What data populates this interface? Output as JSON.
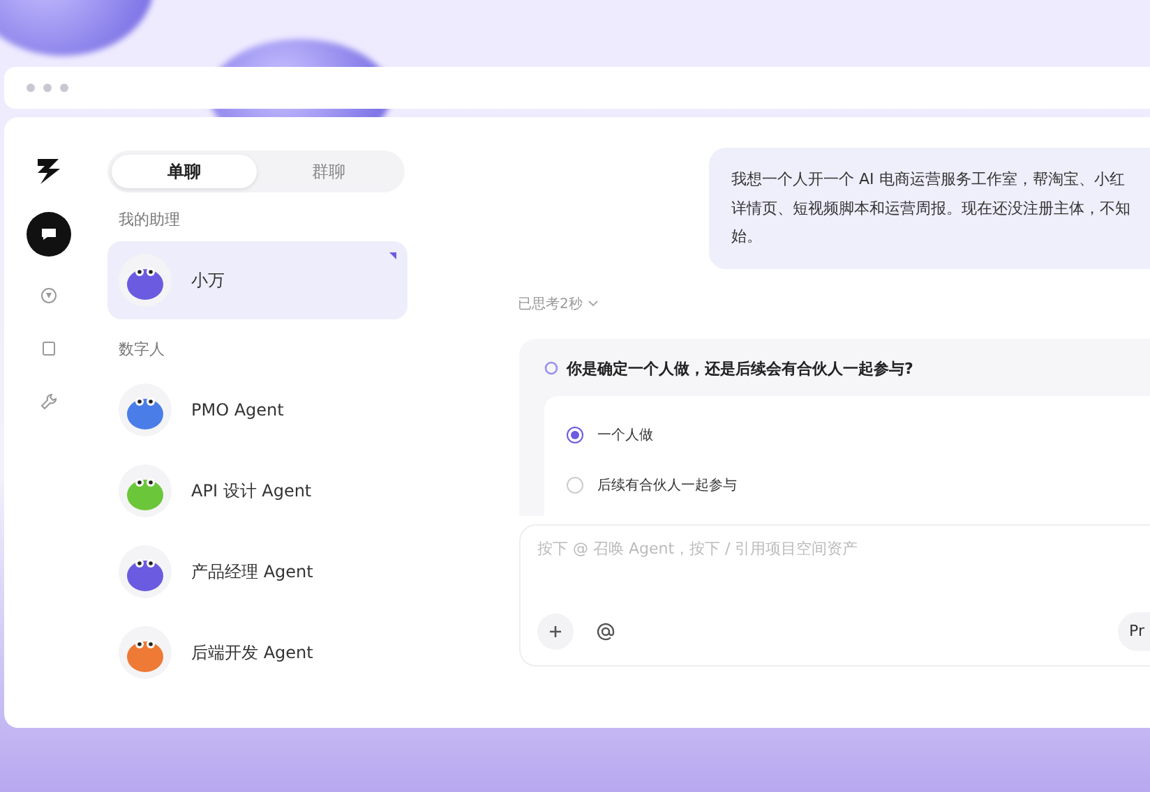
{
  "rail": {
    "items": [
      {
        "kind": "chat",
        "selected": true
      },
      {
        "kind": "explore",
        "selected": false
      },
      {
        "kind": "doc",
        "selected": false
      },
      {
        "kind": "tool",
        "selected": false
      }
    ]
  },
  "list": {
    "tabs": [
      {
        "label": "单聊",
        "selected": true
      },
      {
        "label": "群聊",
        "selected": false
      }
    ],
    "sections": [
      {
        "title": "我的助理",
        "items": [
          {
            "name": "小万",
            "color": "#6b5be0",
            "selected": true
          }
        ]
      },
      {
        "title": "数字人",
        "items": [
          {
            "name": "PMO Agent",
            "color": "#4a7de8",
            "selected": false
          },
          {
            "name": "API 设计 Agent",
            "color": "#6cc63a",
            "selected": false
          },
          {
            "name": "产品经理 Agent",
            "color": "#6b5be0",
            "selected": false
          },
          {
            "name": "后端开发 Agent",
            "color": "#ee7a35",
            "selected": false
          }
        ]
      }
    ]
  },
  "chat": {
    "user_message": [
      "我想一个人开一个 AI 电商运营服务工作室，帮淘宝、小红",
      "详情页、短视频脚本和运营周报。现在还没注册主体，不知",
      "始。"
    ],
    "thinking": "已思考2秒",
    "question": {
      "text": "你是确定一个人做，还是后续会有合伙人一起参与?",
      "options": [
        {
          "label": "一个人做",
          "selected": true
        },
        {
          "label": "后续有合伙人一起参与",
          "selected": false
        }
      ]
    },
    "input": {
      "placeholder": "按下 @ 召唤 Agent，按下 / 引用项目空间资产",
      "right_button": "Pr"
    }
  }
}
